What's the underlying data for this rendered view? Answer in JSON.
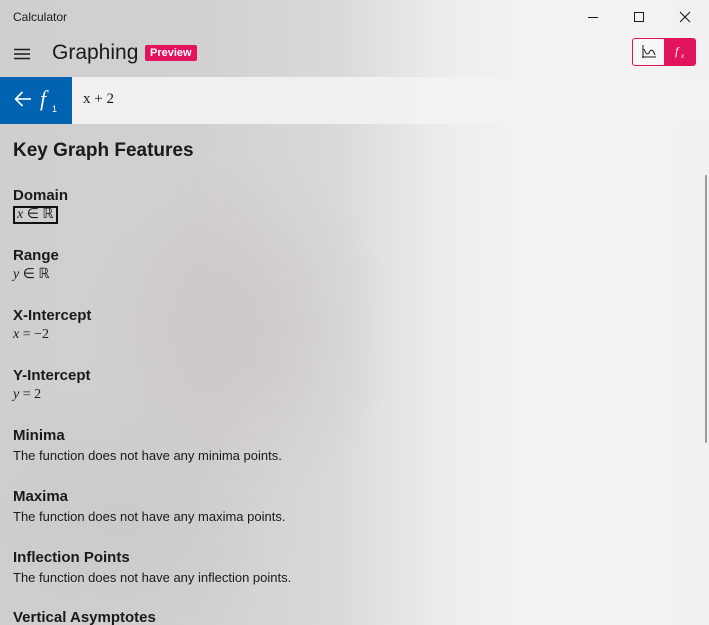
{
  "window": {
    "title": "Calculator",
    "controls": {
      "minimize": "minimize-icon",
      "maximize": "maximize-icon",
      "close": "close-icon"
    }
  },
  "header": {
    "title": "Graphing",
    "badge": "Preview",
    "accent_color": "#e3125c",
    "mode_toggle": [
      "graph-icon",
      "function-icon"
    ]
  },
  "function_bar": {
    "back_icon": "arrow-left-icon",
    "function_name": "f",
    "function_index": "1",
    "expression": "x + 2",
    "accent_color": "#0063b1"
  },
  "content": {
    "title": "Key Graph Features",
    "features": [
      {
        "label": "Domain",
        "var": "x",
        "rest": " ∈ ℝ"
      },
      {
        "label": "Range",
        "var": "y",
        "rest": " ∈ ℝ"
      },
      {
        "label": "X-Intercept",
        "var": "x",
        "rest": " = −2"
      },
      {
        "label": "Y-Intercept",
        "var": "y",
        "rest": " = 2"
      },
      {
        "label": "Minima",
        "text": "The function does not have any minima points."
      },
      {
        "label": "Maxima",
        "text": "The function does not have any maxima points."
      },
      {
        "label": "Inflection Points",
        "text": "The function does not have any inflection points."
      },
      {
        "label": "Vertical Asymptotes"
      }
    ]
  }
}
